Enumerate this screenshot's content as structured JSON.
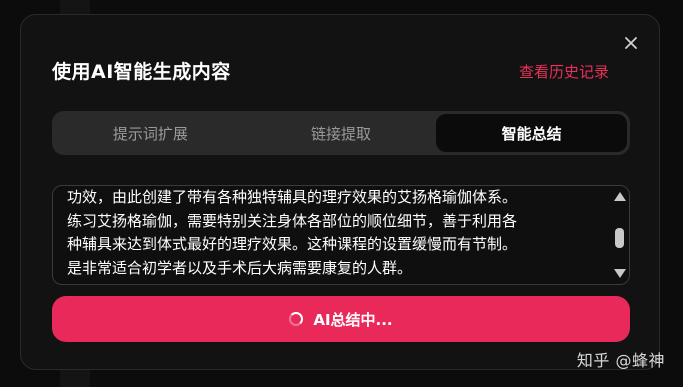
{
  "dialog": {
    "title": "使用AI智能生成内容",
    "history_link": "查看历史记录",
    "close_icon": "close-icon"
  },
  "tabs": [
    {
      "label": "提示词扩展",
      "active": false
    },
    {
      "label": "链接提取",
      "active": false
    },
    {
      "label": "智能总结",
      "active": true
    }
  ],
  "content": {
    "lines": [
      "功效，由此创建了带有各种独特辅具的理疗效果的艾扬格瑜伽体系。",
      "练习艾扬格瑜伽，需要特别关注身体各部位的顺位细节，善于利用各",
      "种辅具来达到体式最好的理疗效果。这种课程的设置缓慢而有节制。",
      "是非常适合初学者以及手术后大病需要康复的人群。"
    ]
  },
  "primary_button": {
    "label": "AI总结中...",
    "icon": "spinner-icon"
  },
  "watermark": "知乎 @蜂神",
  "colors": {
    "accent": "#e8295a",
    "link": "#e8305a",
    "background": "#121212"
  }
}
